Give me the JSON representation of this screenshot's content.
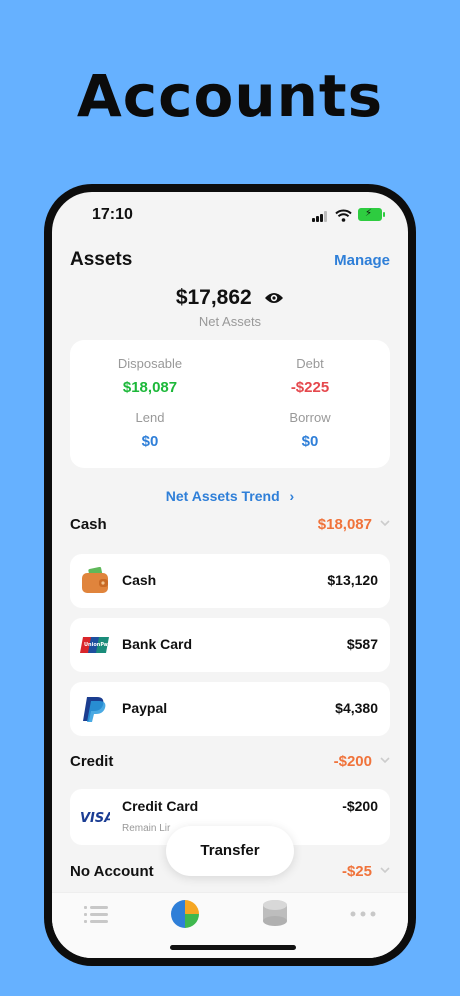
{
  "headline": "Accounts",
  "status_bar": {
    "time": "17:10"
  },
  "header": {
    "title": "Assets",
    "manage_label": "Manage"
  },
  "net_assets": {
    "amount": "$17,862",
    "label": "Net Assets"
  },
  "summary": {
    "disposable": {
      "label": "Disposable",
      "value": "$18,087",
      "color": "#1db83a"
    },
    "debt": {
      "label": "Debt",
      "value": "-$225",
      "color": "#e5484d"
    },
    "lend": {
      "label": "Lend",
      "value": "$0",
      "color": "#2f7fd8"
    },
    "borrow": {
      "label": "Borrow",
      "value": "$0",
      "color": "#2f7fd8"
    }
  },
  "trend_link": "Net Assets Trend",
  "sections": {
    "cash": {
      "name": "Cash",
      "amount": "$18,087",
      "items": [
        {
          "name": "Cash",
          "amount": "$13,120",
          "icon": "wallet-icon"
        },
        {
          "name": "Bank Card",
          "amount": "$587",
          "icon": "unionpay-icon"
        },
        {
          "name": "Paypal",
          "amount": "$4,380",
          "icon": "paypal-icon"
        }
      ]
    },
    "credit": {
      "name": "Credit",
      "amount": "-$200",
      "items": [
        {
          "name": "Credit Card",
          "amount": "-$200",
          "sub": "Remain Lir",
          "icon": "visa-icon"
        }
      ]
    },
    "no_account": {
      "name": "No Account",
      "amount": "-$25"
    }
  },
  "transfer_label": "Transfer",
  "tabs": [
    {
      "icon": "list-icon"
    },
    {
      "icon": "pie-chart-icon",
      "active": true
    },
    {
      "icon": "coins-icon"
    },
    {
      "icon": "more-icon"
    }
  ],
  "accent_color": "#2f7fd8"
}
